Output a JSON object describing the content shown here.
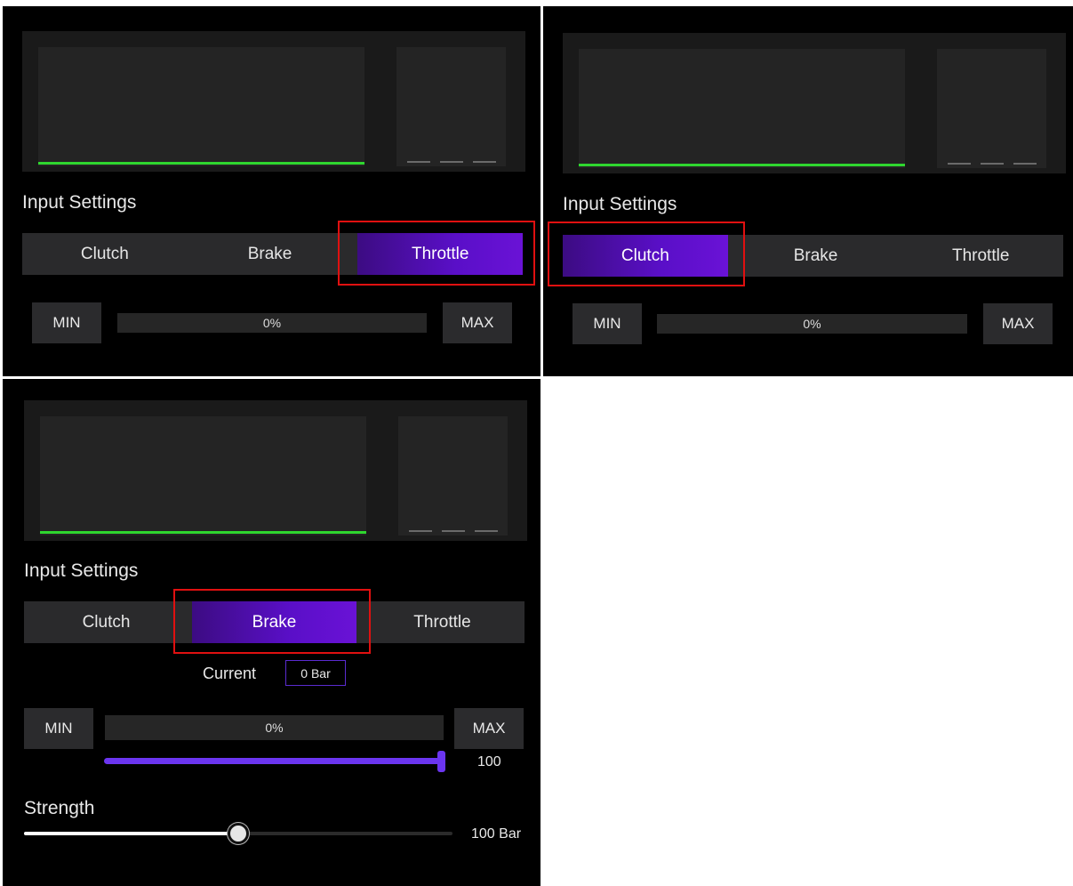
{
  "colors": {
    "background": "#000000",
    "graph_bg": "#1a1a1a",
    "tab_bg": "#2a2a2c",
    "active_tab": "#5a0fc8",
    "green_line": "#2fd62f",
    "highlight": "#e01010",
    "range_accent": "#6b35f0"
  },
  "panels": {
    "throttle": {
      "section_title": "Input Settings",
      "tabs": [
        "Clutch",
        "Brake",
        "Throttle"
      ],
      "active_tab": "Throttle",
      "min_label": "MIN",
      "max_label": "MAX",
      "progress_text": "0%"
    },
    "clutch": {
      "section_title": "Input Settings",
      "tabs": [
        "Clutch",
        "Brake",
        "Throttle"
      ],
      "active_tab": "Clutch",
      "min_label": "MIN",
      "max_label": "MAX",
      "progress_text": "0%"
    },
    "brake": {
      "section_title": "Input Settings",
      "tabs": [
        "Clutch",
        "Brake",
        "Throttle"
      ],
      "active_tab": "Brake",
      "current_label": "Current",
      "current_value": "0 Bar",
      "min_label": "MIN",
      "max_label": "MAX",
      "progress_text": "0%",
      "range_value": "100",
      "range_level": 1.0,
      "strength_label": "Strength",
      "strength_value": "100 Bar",
      "strength_level": 0.5
    }
  }
}
